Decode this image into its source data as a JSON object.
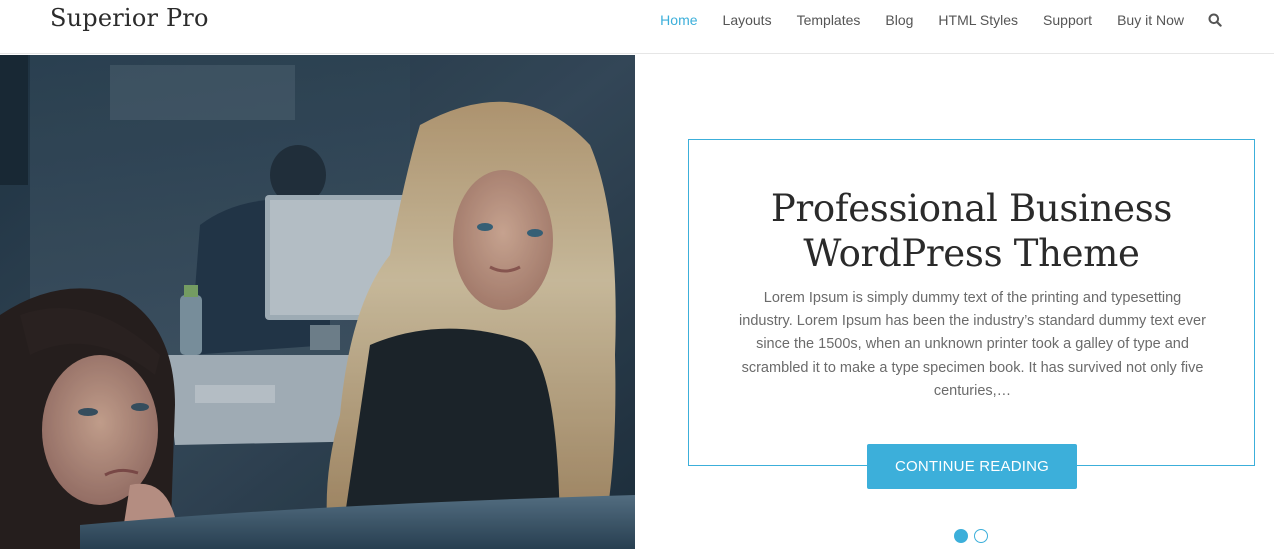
{
  "header": {
    "site_title": "Superior Pro",
    "nav": [
      {
        "label": "Home",
        "active": true
      },
      {
        "label": "Layouts",
        "active": false
      },
      {
        "label": "Templates",
        "active": false
      },
      {
        "label": "Blog",
        "active": false
      },
      {
        "label": "HTML Styles",
        "active": false
      },
      {
        "label": "Support",
        "active": false
      },
      {
        "label": "Buy it Now",
        "active": false
      }
    ],
    "search_icon": "search-icon"
  },
  "hero": {
    "image_description": "Two women looking at a computer screen in an office",
    "title_line1": "Professional Business",
    "title_line2": "WordPress Theme",
    "excerpt": "Lorem Ipsum is simply dummy text of the printing and typesetting industry. Lorem Ipsum has been the industry’s standard dummy text ever since the 1500s, when an unknown printer took a galley of type and scrambled it to make a type specimen book. It has survived not only five centuries,…",
    "button_label": "CONTINUE READING",
    "slides_total": 2,
    "active_slide": 1
  },
  "colors": {
    "accent": "#3cafda",
    "title_text": "#2a2a2a",
    "body_text": "#6b6b6b",
    "nav_text": "#555555"
  }
}
